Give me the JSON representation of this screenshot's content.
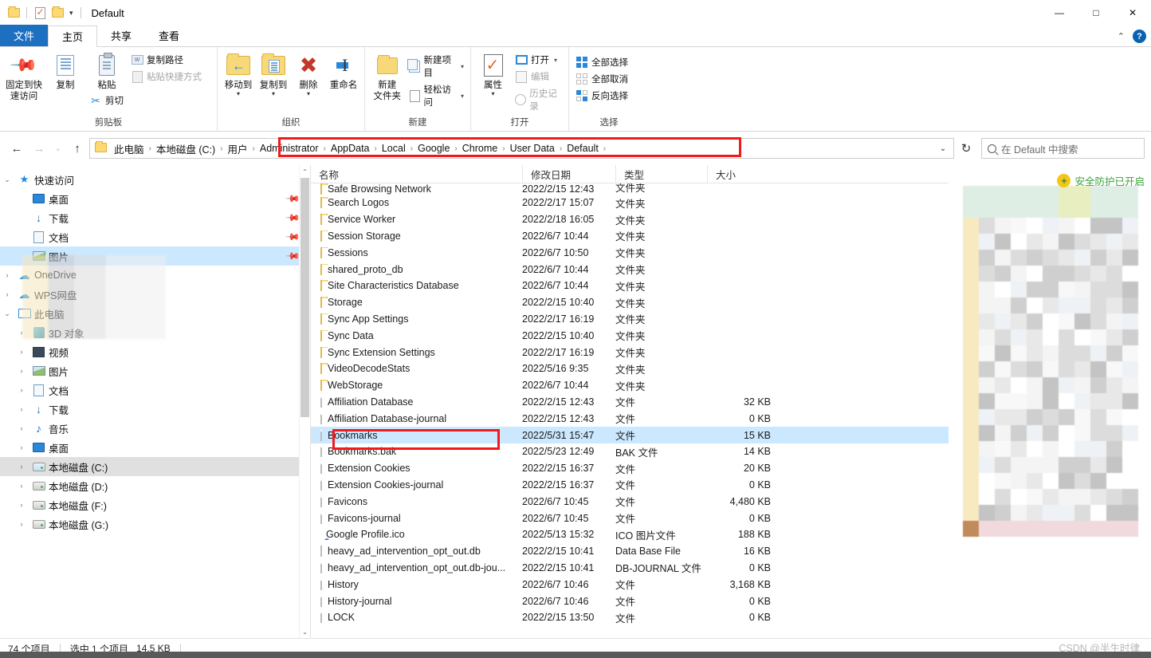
{
  "window": {
    "title": "Default",
    "minimize_label": "—",
    "maximize_label": "□",
    "close_label": "✕"
  },
  "quick_access_toolbar": {
    "items": [
      {
        "name": "folder-icon",
        "label": ""
      },
      {
        "name": "properties-icon",
        "label": ""
      },
      {
        "name": "new-folder-icon",
        "label": ""
      },
      {
        "name": "customize-caret",
        "label": "▾"
      }
    ]
  },
  "tabs": [
    {
      "id": "file",
      "label": "文件"
    },
    {
      "id": "home",
      "label": "主页"
    },
    {
      "id": "share",
      "label": "共享"
    },
    {
      "id": "view",
      "label": "查看"
    }
  ],
  "tabbar_right": {
    "collapse_label": "⌃",
    "help_label": "?"
  },
  "ribbon": {
    "groups": [
      {
        "id": "clipboard",
        "title": "剪贴板",
        "big_buttons": [
          {
            "label": "固定到快速访问",
            "line1": "固定到快",
            "line2": "速访问",
            "icon": "pin-icon"
          },
          {
            "label": "复制",
            "line1": "复制",
            "line2": "",
            "icon": "copy-icon"
          },
          {
            "label": "粘贴",
            "line1": "粘贴",
            "line2": "",
            "icon": "paste-icon"
          }
        ],
        "small_buttons": [
          {
            "label": "复制路径",
            "icon": "copy-path-icon",
            "disabled": false
          },
          {
            "label": "粘贴快捷方式",
            "icon": "paste-shortcut-icon",
            "disabled": true
          }
        ],
        "extra_small": [
          {
            "label": "剪切",
            "icon": "scissors-icon"
          }
        ]
      },
      {
        "id": "organize",
        "title": "组织",
        "big_buttons": [
          {
            "label": "移动到",
            "line1": "移动到",
            "line2": "",
            "icon": "move-to-icon",
            "has_caret": true
          },
          {
            "label": "复制到",
            "line1": "复制到",
            "line2": "",
            "icon": "copy-to-icon",
            "has_caret": true
          },
          {
            "label": "删除",
            "line1": "删除",
            "line2": "",
            "icon": "delete-icon",
            "has_caret": true
          },
          {
            "label": "重命名",
            "line1": "重命名",
            "line2": "",
            "icon": "rename-icon"
          }
        ]
      },
      {
        "id": "new",
        "title": "新建",
        "big_buttons": [
          {
            "label": "新建文件夹",
            "line1": "新建",
            "line2": "文件夹",
            "icon": "new-folder-icon"
          }
        ],
        "small_buttons": [
          {
            "label": "新建项目",
            "icon": "new-item-icon",
            "has_caret": true
          },
          {
            "label": "轻松访问",
            "icon": "easy-access-icon",
            "has_caret": true
          }
        ]
      },
      {
        "id": "open",
        "title": "打开",
        "big_buttons": [
          {
            "label": "属性",
            "line1": "属性",
            "line2": "",
            "icon": "properties-icon",
            "has_caret": true
          }
        ],
        "small_buttons": [
          {
            "label": "打开",
            "icon": "open-icon",
            "has_caret": true,
            "disabled": false
          },
          {
            "label": "编辑",
            "icon": "edit-icon",
            "disabled": true
          },
          {
            "label": "历史记录",
            "icon": "history-icon",
            "disabled": true
          }
        ]
      },
      {
        "id": "select",
        "title": "选择",
        "small_buttons": [
          {
            "label": "全部选择",
            "icon": "select-all-icon"
          },
          {
            "label": "全部取消",
            "icon": "select-none-icon"
          },
          {
            "label": "反向选择",
            "icon": "invert-selection-icon"
          }
        ]
      }
    ]
  },
  "addressbar": {
    "back_label": "←",
    "forward_label": "→",
    "recent_label": "⌄",
    "up_label": "↑",
    "breadcrumbs": [
      "此电脑",
      "本地磁盘 (C:)",
      "用户",
      "Administrator",
      "AppData",
      "Local",
      "Google",
      "Chrome",
      "User Data",
      "Default"
    ],
    "separator": "›",
    "dropdown_label": "⌄",
    "refresh_label": "↻"
  },
  "search": {
    "placeholder": "在 Default 中搜索"
  },
  "sidebar": {
    "scroll_up": "⌃",
    "scroll_down": "⌄",
    "items": [
      {
        "label": "快速访问",
        "icon": "quick-access-star-icon",
        "expander": "⌄",
        "indent": 0,
        "pinned": false,
        "selected": false
      },
      {
        "label": "桌面",
        "icon": "desktop-icon",
        "expander": "",
        "indent": 1,
        "pinned": true,
        "selected": false
      },
      {
        "label": "下载",
        "icon": "downloads-icon",
        "expander": "",
        "indent": 1,
        "pinned": true,
        "selected": false
      },
      {
        "label": "文档",
        "icon": "documents-icon",
        "expander": "",
        "indent": 1,
        "pinned": true,
        "selected": false
      },
      {
        "label": "图片",
        "icon": "pictures-icon",
        "expander": "",
        "indent": 1,
        "pinned": true,
        "selected": true
      },
      {
        "label": "OneDrive",
        "icon": "onedrive-icon",
        "expander": "›",
        "indent": 0,
        "pinned": false,
        "selected": false
      },
      {
        "label": "WPS网盘",
        "icon": "wps-cloud-icon",
        "expander": "›",
        "indent": 0,
        "pinned": false,
        "selected": false
      },
      {
        "label": "此电脑",
        "icon": "this-pc-icon",
        "expander": "⌄",
        "indent": 0,
        "pinned": false,
        "selected": false
      },
      {
        "label": "3D 对象",
        "icon": "3d-objects-icon",
        "expander": "›",
        "indent": 1,
        "pinned": false,
        "selected": false
      },
      {
        "label": "视频",
        "icon": "videos-icon",
        "expander": "›",
        "indent": 1,
        "pinned": false,
        "selected": false
      },
      {
        "label": "图片",
        "icon": "pictures-icon",
        "expander": "›",
        "indent": 1,
        "pinned": false,
        "selected": false
      },
      {
        "label": "文档",
        "icon": "documents-icon",
        "expander": "›",
        "indent": 1,
        "pinned": false,
        "selected": false
      },
      {
        "label": "下载",
        "icon": "downloads-icon",
        "expander": "›",
        "indent": 1,
        "pinned": false,
        "selected": false
      },
      {
        "label": "音乐",
        "icon": "music-icon",
        "expander": "›",
        "indent": 1,
        "pinned": false,
        "selected": false
      },
      {
        "label": "桌面",
        "icon": "desktop-icon",
        "expander": "›",
        "indent": 1,
        "pinned": false,
        "selected": false
      },
      {
        "label": "本地磁盘 (C:)",
        "icon": "system-drive-icon",
        "expander": "›",
        "indent": 1,
        "pinned": false,
        "selected": false,
        "highlight": true
      },
      {
        "label": "本地磁盘 (D:)",
        "icon": "drive-icon",
        "expander": "›",
        "indent": 1,
        "pinned": false,
        "selected": false
      },
      {
        "label": "本地磁盘 (F:)",
        "icon": "drive-icon",
        "expander": "›",
        "indent": 1,
        "pinned": false,
        "selected": false
      },
      {
        "label": "本地磁盘 (G:)",
        "icon": "drive-icon",
        "expander": "›",
        "indent": 1,
        "pinned": false,
        "selected": false
      }
    ]
  },
  "filelist": {
    "columns": [
      {
        "key": "name",
        "label": "名称",
        "sorted": true,
        "sort_mark": "⌃"
      },
      {
        "key": "date",
        "label": "修改日期"
      },
      {
        "key": "type",
        "label": "类型"
      },
      {
        "key": "size",
        "label": "大小"
      }
    ],
    "rows": [
      {
        "name": "Safe Browsing Network",
        "date": "2022/2/15 12:43",
        "type": "文件夹",
        "size": "",
        "icon": "folder-icon",
        "clipped": true
      },
      {
        "name": "Search Logos",
        "date": "2022/2/17 15:07",
        "type": "文件夹",
        "size": "",
        "icon": "folder-icon"
      },
      {
        "name": "Service Worker",
        "date": "2022/2/18 16:05",
        "type": "文件夹",
        "size": "",
        "icon": "folder-icon"
      },
      {
        "name": "Session Storage",
        "date": "2022/6/7 10:44",
        "type": "文件夹",
        "size": "",
        "icon": "folder-icon"
      },
      {
        "name": "Sessions",
        "date": "2022/6/7 10:50",
        "type": "文件夹",
        "size": "",
        "icon": "folder-icon"
      },
      {
        "name": "shared_proto_db",
        "date": "2022/6/7 10:44",
        "type": "文件夹",
        "size": "",
        "icon": "folder-icon"
      },
      {
        "name": "Site Characteristics Database",
        "date": "2022/6/7 10:44",
        "type": "文件夹",
        "size": "",
        "icon": "folder-icon"
      },
      {
        "name": "Storage",
        "date": "2022/2/15 10:40",
        "type": "文件夹",
        "size": "",
        "icon": "folder-icon"
      },
      {
        "name": "Sync App Settings",
        "date": "2022/2/17 16:19",
        "type": "文件夹",
        "size": "",
        "icon": "folder-icon"
      },
      {
        "name": "Sync Data",
        "date": "2022/2/15 10:40",
        "type": "文件夹",
        "size": "",
        "icon": "folder-icon"
      },
      {
        "name": "Sync Extension Settings",
        "date": "2022/2/17 16:19",
        "type": "文件夹",
        "size": "",
        "icon": "folder-icon"
      },
      {
        "name": "VideoDecodeStats",
        "date": "2022/5/16 9:35",
        "type": "文件夹",
        "size": "",
        "icon": "folder-icon"
      },
      {
        "name": "WebStorage",
        "date": "2022/6/7 10:44",
        "type": "文件夹",
        "size": "",
        "icon": "folder-icon"
      },
      {
        "name": "Affiliation Database",
        "date": "2022/2/15 12:43",
        "type": "文件",
        "size": "32 KB",
        "icon": "file-icon"
      },
      {
        "name": "Affiliation Database-journal",
        "date": "2022/2/15 12:43",
        "type": "文件",
        "size": "0 KB",
        "icon": "file-icon"
      },
      {
        "name": "Bookmarks",
        "date": "2022/5/31 15:47",
        "type": "文件",
        "size": "15 KB",
        "icon": "file-icon",
        "selected": true
      },
      {
        "name": "Bookmarks.bak",
        "date": "2022/5/23 12:49",
        "type": "BAK 文件",
        "size": "14 KB",
        "icon": "file-icon"
      },
      {
        "name": "Extension Cookies",
        "date": "2022/2/15 16:37",
        "type": "文件",
        "size": "20 KB",
        "icon": "file-icon"
      },
      {
        "name": "Extension Cookies-journal",
        "date": "2022/2/15 16:37",
        "type": "文件",
        "size": "0 KB",
        "icon": "file-icon"
      },
      {
        "name": "Favicons",
        "date": "2022/6/7 10:45",
        "type": "文件",
        "size": "4,480 KB",
        "icon": "file-icon"
      },
      {
        "name": "Favicons-journal",
        "date": "2022/6/7 10:45",
        "type": "文件",
        "size": "0 KB",
        "icon": "file-icon"
      },
      {
        "name": "Google Profile.ico",
        "date": "2022/5/13 15:32",
        "type": "ICO 图片文件",
        "size": "188 KB",
        "icon": "chrome-icon"
      },
      {
        "name": "heavy_ad_intervention_opt_out.db",
        "date": "2022/2/15 10:41",
        "type": "Data Base File",
        "size": "16 KB",
        "icon": "db-icon"
      },
      {
        "name": "heavy_ad_intervention_opt_out.db-jou...",
        "date": "2022/2/15 10:41",
        "type": "DB-JOURNAL 文件",
        "size": "0 KB",
        "icon": "file-icon"
      },
      {
        "name": "History",
        "date": "2022/6/7 10:46",
        "type": "文件",
        "size": "3,168 KB",
        "icon": "file-icon"
      },
      {
        "name": "History-journal",
        "date": "2022/6/7 10:46",
        "type": "文件",
        "size": "0 KB",
        "icon": "file-icon"
      },
      {
        "name": "LOCK",
        "date": "2022/2/15 13:50",
        "type": "文件",
        "size": "0 KB",
        "icon": "file-icon"
      }
    ],
    "scroll_up": "⌃",
    "scroll_down": "⌄"
  },
  "notification": {
    "text": "安全防护已开启",
    "icon": "shield-plus-icon",
    "color": "#3aa03a"
  },
  "statusbar": {
    "item_count": "74 个项目",
    "selection": "选中 1 个项目",
    "selection_size": "14.5 KB"
  },
  "watermark": {
    "text": "CSDN @半生时律"
  },
  "annotations": {
    "accent_color": "#f21b1b",
    "boxes": [
      {
        "name": "path-highlight",
        "target": "address-bar-breadcrumbs"
      },
      {
        "name": "bookmarks-highlight",
        "target": "bookmarks-row"
      }
    ]
  }
}
